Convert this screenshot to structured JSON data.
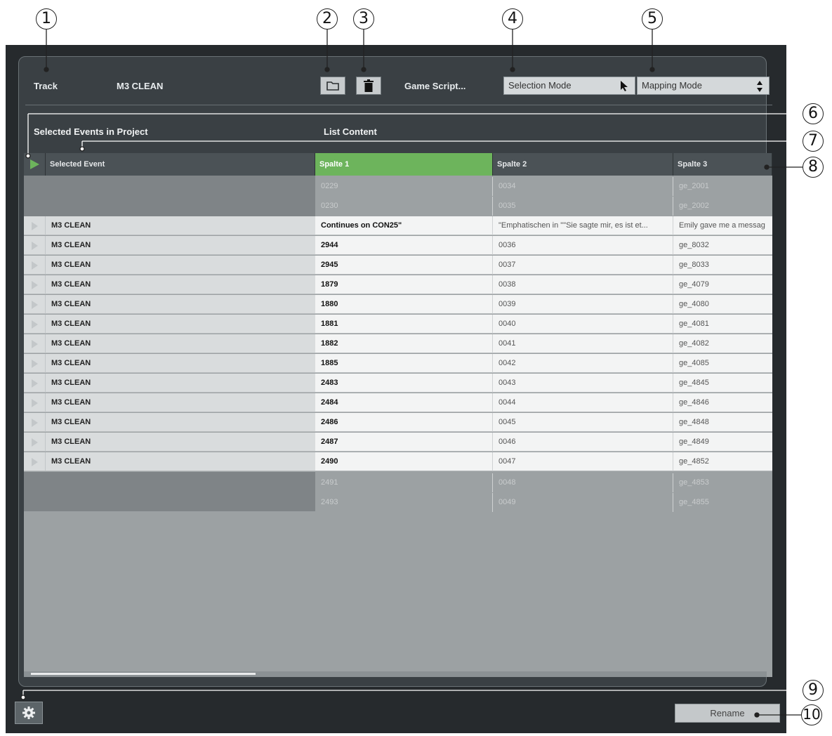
{
  "callouts": [
    "1",
    "2",
    "3",
    "4",
    "5",
    "6",
    "7",
    "8",
    "9",
    "10"
  ],
  "toolbar": {
    "track_label": "Track",
    "track_value": "M3 CLEAN",
    "folder_icon": "folder-icon",
    "trash_icon": "trash-icon",
    "game_script": "Game Script...",
    "selection_mode": "Selection Mode",
    "mapping_mode": "Mapping Mode"
  },
  "sections": {
    "selected_events": "Selected Events in Project",
    "list_content": "List Content"
  },
  "table": {
    "headers": {
      "event": "Selected Event",
      "col1": "Spalte 1",
      "col2": "Spalte 2",
      "col3": "Spalte 3"
    },
    "ghost_top": [
      [
        "0229",
        "0034",
        "ge_2001"
      ],
      [
        "0230",
        "0035",
        "ge_2002"
      ]
    ],
    "rows": [
      [
        "M3 CLEAN",
        "Continues on CON25\"",
        "\"Emphatischen in \"\"Sie sagte mir, es ist et...",
        "Emily gave me a messag"
      ],
      [
        "M3 CLEAN",
        "2944",
        "0036",
        "ge_8032"
      ],
      [
        "M3 CLEAN",
        "2945",
        "0037",
        "ge_8033"
      ],
      [
        "M3 CLEAN",
        "1879",
        "0038",
        "ge_4079"
      ],
      [
        "M3 CLEAN",
        "1880",
        "0039",
        "ge_4080"
      ],
      [
        "M3 CLEAN",
        "1881",
        "0040",
        "ge_4081"
      ],
      [
        "M3 CLEAN",
        "1882",
        "0041",
        "ge_4082"
      ],
      [
        "M3 CLEAN",
        "1885",
        "0042",
        "ge_4085"
      ],
      [
        "M3 CLEAN",
        "2483",
        "0043",
        "ge_4845"
      ],
      [
        "M3 CLEAN",
        "2484",
        "0044",
        "ge_4846"
      ],
      [
        "M3 CLEAN",
        "2486",
        "0045",
        "ge_4848"
      ],
      [
        "M3 CLEAN",
        "2487",
        "0046",
        "ge_4849"
      ],
      [
        "M3 CLEAN",
        "2490",
        "0047",
        "ge_4852"
      ]
    ],
    "ghost_bottom": [
      [
        "2491",
        "0048",
        "ge_4853"
      ],
      [
        "2493",
        "0049",
        "ge_4855"
      ]
    ]
  },
  "footer": {
    "settings_icon": "gear-icon",
    "rename": "Rename"
  },
  "colors": {
    "accent_green": "#6db45c",
    "window_bg": "#262a2d",
    "panel_bg": "#3a4044"
  }
}
